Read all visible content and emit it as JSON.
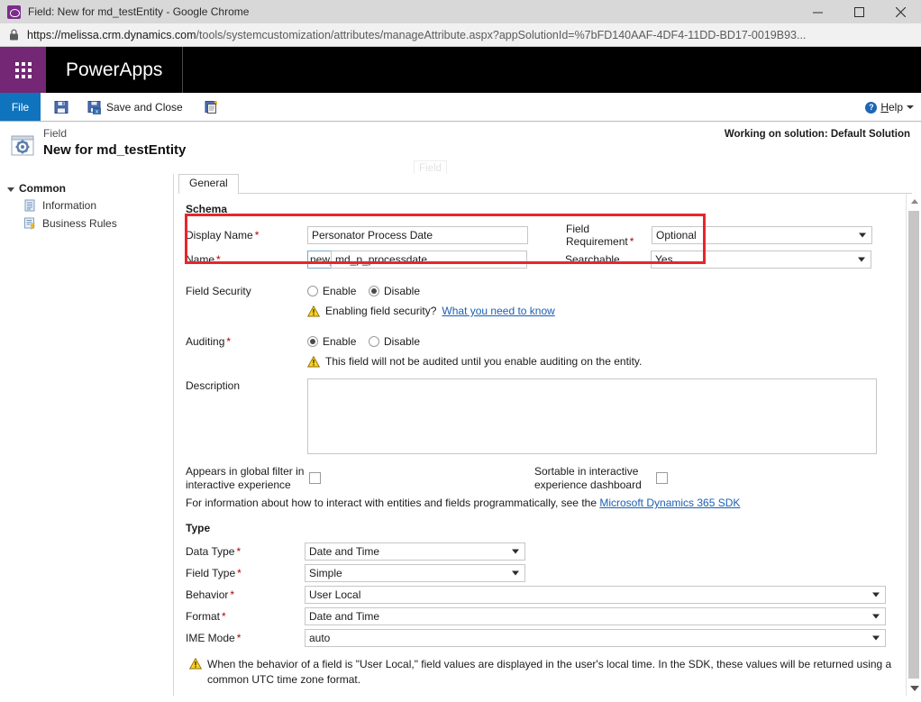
{
  "browser": {
    "title": "Field: New for md_testEntity - Google Chrome",
    "favicon": "powerapps-favicon",
    "url_host": "https://melissa.crm.dynamics.com",
    "url_path": "/tools/systemcustomization/attributes/manageAttribute.aspx?appSolutionId=%7bFD140AAF-4DF4-11DD-BD17-0019B93...",
    "minimize_label": "minimize-icon",
    "maximize_label": "maximize-icon",
    "close_label": "close-icon",
    "lock_label": "lock-icon"
  },
  "appbar": {
    "waffle": "app-launcher-icon",
    "brand": "PowerApps"
  },
  "ribbon": {
    "file_label": "File",
    "save_label": "",
    "save_and_close_label": "Save and Close",
    "new_label": "",
    "help_label_pre": "H",
    "help_label_post": "elp",
    "help_icon": "help-icon"
  },
  "page": {
    "kicker": "Field",
    "title": "New for md_testEntity",
    "ghost_watermark": "Field",
    "solution_note": "Working on solution: Default Solution"
  },
  "sidebar": {
    "group_label": "Common",
    "items": [
      {
        "label": "Information",
        "icon": "information-icon"
      },
      {
        "label": "Business Rules",
        "icon": "business-rules-icon"
      }
    ]
  },
  "tabs": [
    {
      "label": "General",
      "selected": true
    }
  ],
  "form": {
    "schema_section": "Schema",
    "display_name_label": "Display Name",
    "display_name_value": "Personator Process Date",
    "display_name_required": "*",
    "name_label": "Name",
    "name_required": "*",
    "name_prefix": "new_",
    "name_value": "md_p_processdate",
    "field_requirement_label": "Field Requirement",
    "field_requirement_required": "*",
    "field_requirement_value": "Optional",
    "searchable_label": "Searchable",
    "searchable_value": "Yes",
    "field_security_label": "Field Security",
    "field_security_enable": "Enable",
    "field_security_disable": "Disable",
    "field_security_selected": "Disable",
    "field_security_warning": "Enabling field security?",
    "field_security_link": "What you need to know",
    "auditing_label": "Auditing",
    "auditing_required": "*",
    "auditing_enable": "Enable",
    "auditing_disable": "Disable",
    "auditing_selected": "Enable",
    "auditing_warning": "This field will not be audited until you enable auditing on the entity.",
    "description_label": "Description",
    "description_value": "",
    "global_filter_label_line1": "Appears in global filter in",
    "global_filter_label_line2": "interactive experience",
    "global_filter_checked": false,
    "sortable_label_line1": "Sortable in interactive",
    "sortable_label_line2": "experience dashboard",
    "sortable_checked": false,
    "sdk_note": "For information about how to interact with entities and fields programmatically, see the",
    "sdk_link": "Microsoft Dynamics 365 SDK",
    "type_section": "Type",
    "data_type_label": "Data Type",
    "data_type_required": "*",
    "data_type_value": "Date and Time",
    "field_type_label": "Field Type",
    "field_type_required": "*",
    "field_type_value": "Simple",
    "behavior_label": "Behavior",
    "behavior_required": "*",
    "behavior_value": "User Local",
    "format_label": "Format",
    "format_required": "*",
    "format_value": "Date and Time",
    "ime_mode_label": "IME Mode",
    "ime_mode_required": "*",
    "ime_mode_value": "auto",
    "behavior_note_line1": "When the behavior of a field is \"User Local,\" field values are displayed in the user's local time. In the SDK, these values will be returned using a common UTC",
    "behavior_note_line2": "time zone format."
  },
  "colors": {
    "accent_purple": "#742774",
    "file_tab_blue": "#1073bd",
    "highlight_red": "#e8262a",
    "link_blue": "#1a5fb4",
    "required_red": "#b00000"
  }
}
